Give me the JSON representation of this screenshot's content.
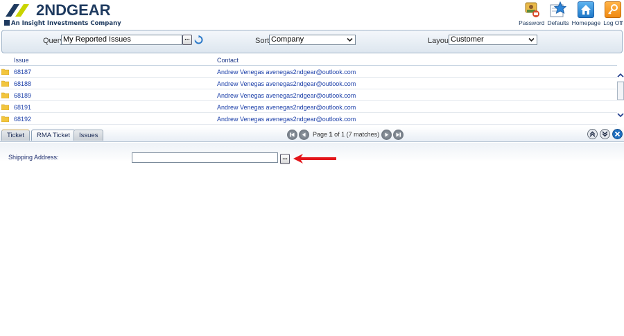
{
  "brand": {
    "name": "2NDGEAR",
    "tagline": "An Insight Investments Company",
    "color": "#1e3a5f",
    "accent": "#c9d400"
  },
  "header_actions": [
    {
      "label": "Password",
      "icon": "password-user-icon"
    },
    {
      "label": "Defaults",
      "icon": "star-icon"
    },
    {
      "label": "Homepage",
      "icon": "home-icon"
    },
    {
      "label": "Log Off",
      "icon": "key-icon"
    }
  ],
  "query_bar": {
    "query_label": "Query:",
    "query_value": "My Reported Issues",
    "query_browse": "...",
    "sort_label": "Sort:",
    "sort_value": "Company",
    "layout_label": "Layout:",
    "layout_value": "Customer"
  },
  "grid": {
    "columns": [
      "Issue",
      "Contact"
    ],
    "rows": [
      {
        "issue": "68187",
        "contact": "Andrew Venegas avenegas2ndgear@outlook.com"
      },
      {
        "issue": "68188",
        "contact": "Andrew Venegas avenegas2ndgear@outlook.com"
      },
      {
        "issue": "68189",
        "contact": "Andrew Venegas avenegas2ndgear@outlook.com"
      },
      {
        "issue": "68191",
        "contact": "Andrew Venegas avenegas2ndgear@outlook.com"
      },
      {
        "issue": "68192",
        "contact": "Andrew Venegas avenegas2ndgear@outlook.com"
      }
    ]
  },
  "tabs": [
    {
      "label": "Ticket",
      "active": false
    },
    {
      "label": "RMA Ticket",
      "active": true
    },
    {
      "label": "Issues",
      "active": false
    }
  ],
  "pager": {
    "page_word": "Page",
    "current_page": "1",
    "of_text": "of 1 (7 matches)"
  },
  "form": {
    "shipping_label": "Shipping Address:",
    "shipping_value": "",
    "browse_label": "..."
  },
  "colors": {
    "link": "#1a3ea8",
    "arrow": "#e3151a",
    "folder": "#f2c53d"
  }
}
